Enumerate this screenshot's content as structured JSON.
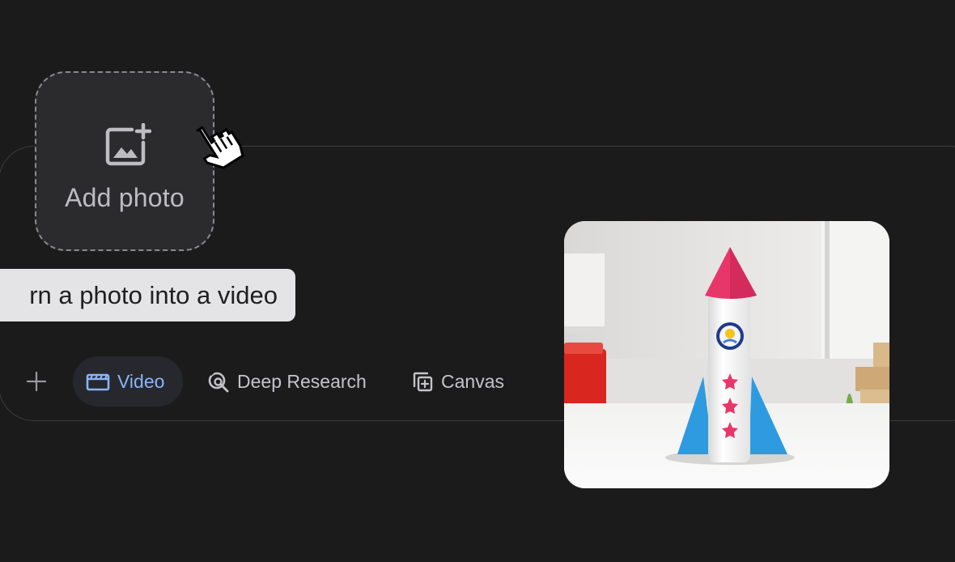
{
  "dropzone": {
    "label": "Add photo",
    "icon": "add-photo-icon"
  },
  "suggestion": {
    "text": "rn a photo into a video"
  },
  "toolbar": {
    "plus_icon": "plus-icon",
    "tools": [
      {
        "label": "Video",
        "icon": "video-icon",
        "active": true
      },
      {
        "label": "Deep Research",
        "icon": "deep-research-icon",
        "active": false
      },
      {
        "label": "Canvas",
        "icon": "canvas-icon",
        "active": false
      }
    ]
  },
  "preview": {
    "icon": "paper-rocket-image"
  },
  "colors": {
    "background": "#1b1b1c",
    "active_accent": "#8ab4f8",
    "rocket_cone": "#e8366a",
    "rocket_fins": "#2e9be0"
  }
}
